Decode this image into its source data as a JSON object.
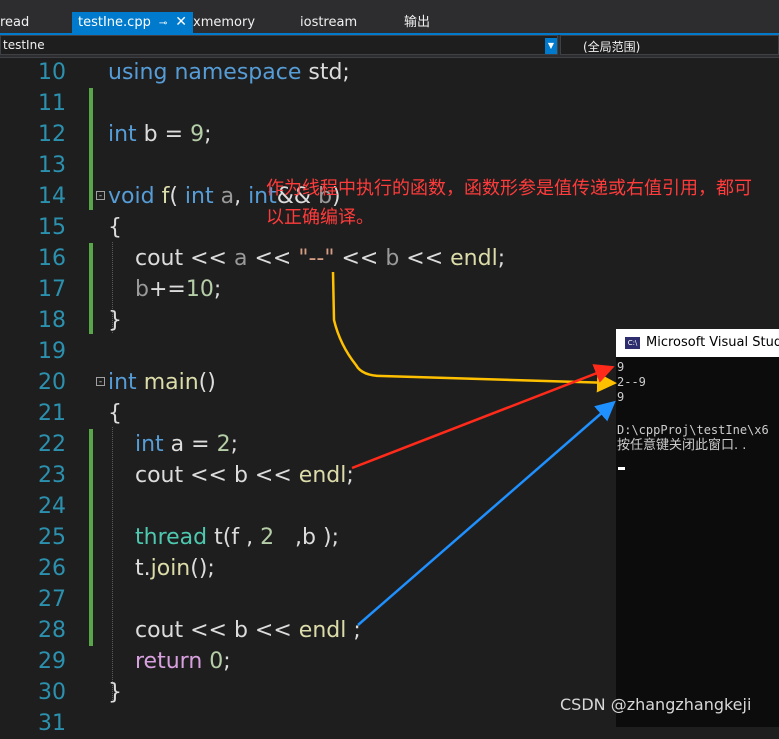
{
  "tabs": [
    {
      "label": "read"
    },
    {
      "label": "testIne.cpp",
      "pin": "⊸",
      "close": "✕"
    },
    {
      "label": "xmemory"
    },
    {
      "label": "iostream"
    },
    {
      "label": "输出"
    }
  ],
  "nav": {
    "scope": "testIne",
    "function": "(全局范围)"
  },
  "line_numbers": [
    "10",
    "11",
    "12",
    "13",
    "14",
    "15",
    "16",
    "17",
    "18",
    "19",
    "20",
    "21",
    "22",
    "23",
    "24",
    "25",
    "26",
    "27",
    "28",
    "29",
    "30",
    "31"
  ],
  "code": {
    "l10": {
      "kw1": "using",
      "kw2": "namespace",
      "rest": " std;"
    },
    "l12": {
      "kw": "int",
      "rest": " b = ",
      "num": "9",
      "end": ";"
    },
    "l14": {
      "kw": "void",
      "fn": "f",
      "p1": "( ",
      "kw2": "int",
      "pa": " a",
      "p2": ", ",
      "kw3": "int",
      "p3": "&& ",
      "pb": "b",
      "p4": ")"
    },
    "l15": {
      "t": "{"
    },
    "l16": {
      "a": "cout << ",
      "pa": "a",
      "b": " << ",
      "s": "\"--\"",
      "c": " << ",
      "pb": "b",
      "d": " << ",
      "fn": "endl",
      "e": ";"
    },
    "l17": {
      "pb": "b",
      "a": "+=",
      "num": "10",
      "e": ";"
    },
    "l18": {
      "t": "}"
    },
    "l20": {
      "kw": "int",
      "fn": "main",
      "p": "()"
    },
    "l21": {
      "t": "{"
    },
    "l22": {
      "kw": "int",
      "a": " a = ",
      "num": "2",
      "e": ";"
    },
    "l23": {
      "a": "cout << b << ",
      "fn": "endl",
      "e": ";"
    },
    "l25": {
      "ty": "thread",
      "a": " t(f , ",
      "num": "2",
      "b": "   ,b );"
    },
    "l26": {
      "a": "t.",
      "fn": "join",
      "b": "();"
    },
    "l28": {
      "a": "cout << b << ",
      "fn": "endl",
      "b": " ;"
    },
    "l29": {
      "fl": "return",
      "a": " ",
      "num": "0",
      "e": ";"
    },
    "l30": {
      "t": "}"
    }
  },
  "annotation": "作为线程中执行的函数，函数形参是值传递或右值引用，都可以正确编译。",
  "console": {
    "title": "Microsoft Visual Studio",
    "icon": "C:\\",
    "lines": [
      "9",
      "2--9",
      "9",
      "",
      "D:\\cppProj\\testIne\\x6",
      "按任意键关闭此窗口. ."
    ]
  },
  "watermark": "CSDN @zhangzhangkeji",
  "colors": {
    "arrow_orange": "#ffc000",
    "arrow_red": "#ff2a1a",
    "arrow_blue": "#1e90ff"
  }
}
